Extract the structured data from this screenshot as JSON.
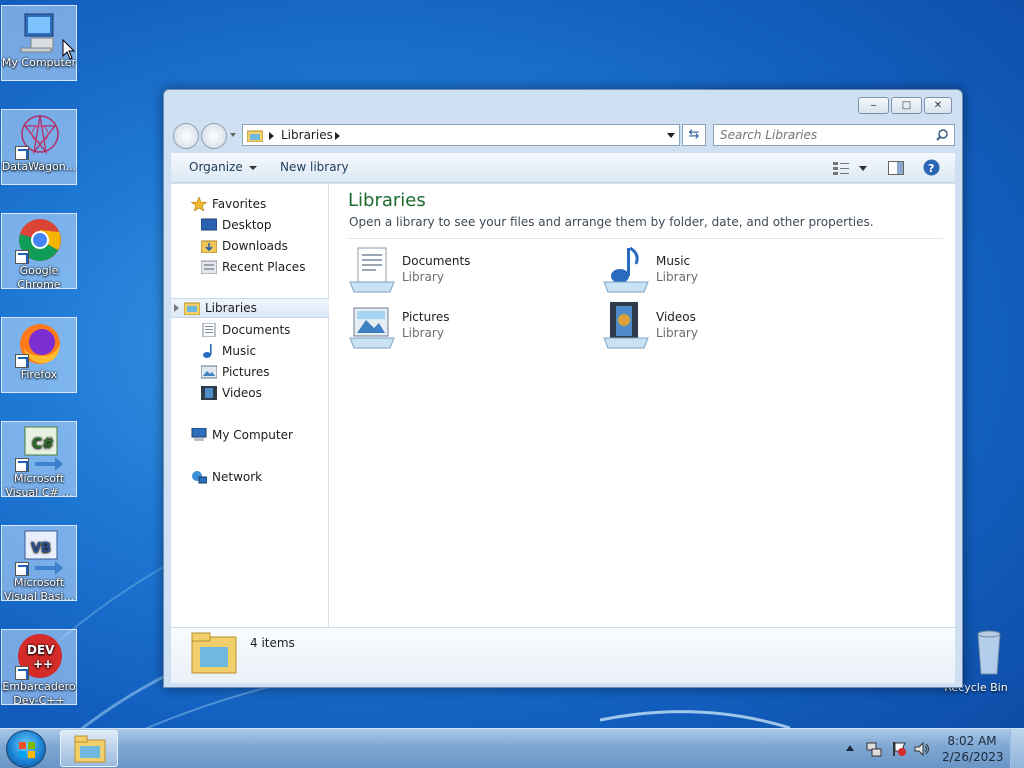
{
  "desktop": {
    "icons": [
      {
        "label": "My Computer"
      },
      {
        "label": "DataWagon..."
      },
      {
        "label": "Google Chrome"
      },
      {
        "label": "Firefox"
      },
      {
        "label": "Microsoft Visual C# ..."
      },
      {
        "label": "Microsoft Visual Basi..."
      },
      {
        "label": "Embarcadero Dev-C++"
      }
    ],
    "recycle_bin": "Recycle Bin"
  },
  "window": {
    "caption_buttons": {
      "minimize": "‒",
      "maximize": "□",
      "close": "✕"
    },
    "address": {
      "crumb": "Libraries"
    },
    "search": {
      "placeholder": "Search Libraries"
    },
    "toolbar": {
      "organize": "Organize",
      "new_library": "New library"
    },
    "nav": {
      "favorites": "Favorites",
      "desktop": "Desktop",
      "downloads": "Downloads",
      "recent_places": "Recent Places",
      "libraries": "Libraries",
      "documents": "Documents",
      "music": "Music",
      "pictures": "Pictures",
      "videos": "Videos",
      "my_computer": "My Computer",
      "network": "Network"
    },
    "main": {
      "title": "Libraries",
      "subtitle": "Open a library to see your files and arrange them by folder, date, and other properties.",
      "items": [
        {
          "name": "Documents",
          "kind": "Library"
        },
        {
          "name": "Music",
          "kind": "Library"
        },
        {
          "name": "Pictures",
          "kind": "Library"
        },
        {
          "name": "Videos",
          "kind": "Library"
        }
      ]
    },
    "details": {
      "count": "4 items"
    }
  },
  "taskbar": {
    "time": "8:02 AM",
    "date": "2/26/2023"
  },
  "colors": {
    "library_title": "#1e6b2f",
    "desktop_blue": "#1f7ad6",
    "taskbar": "#7fa7d2"
  }
}
